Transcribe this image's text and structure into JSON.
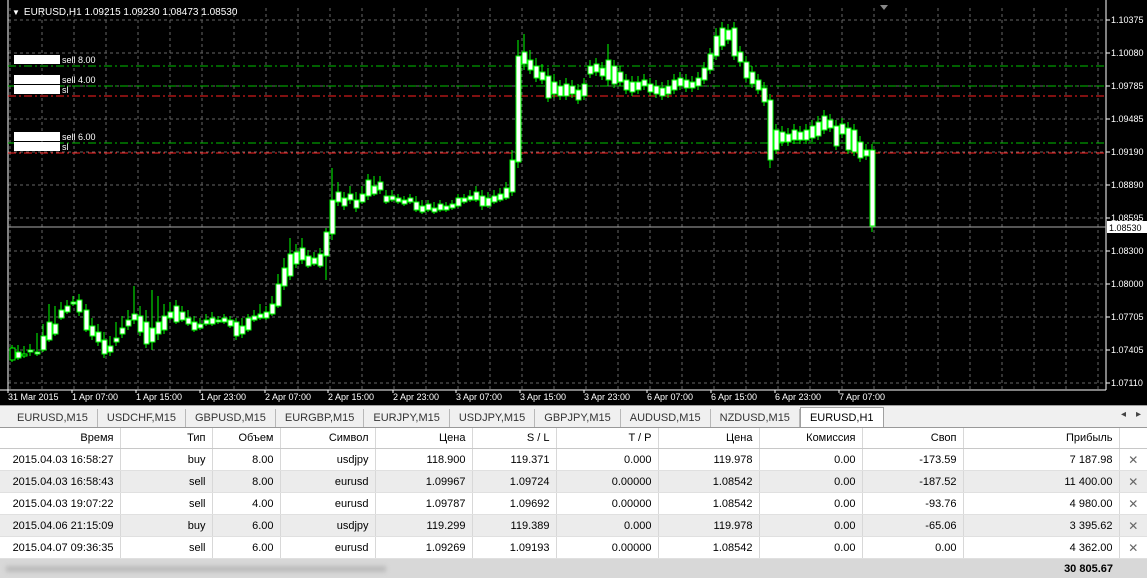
{
  "chart": {
    "title": "EURUSD,H1  1.09215 1.09230 1.08473 1.08530",
    "price_ticks": [
      "1.10375",
      "1.10080",
      "1.09785",
      "1.09485",
      "1.09190",
      "1.08890",
      "1.08595",
      "1.08300",
      "1.08000",
      "1.07705",
      "1.07405",
      "1.07110"
    ],
    "current_price": "1.08530",
    "time_ticks": [
      "31 Mar 2015",
      "1 Apr 07:00",
      "1 Apr 15:00",
      "1 Apr 23:00",
      "2 Apr 07:00",
      "2 Apr 15:00",
      "2 Apr 23:00",
      "3 Apr 07:00",
      "3 Apr 15:00",
      "3 Apr 23:00",
      "6 Apr 07:00",
      "6 Apr 15:00",
      "6 Apr 23:00",
      "7 Apr 07:00"
    ],
    "order_labels": [
      "sell 8.00",
      "sell 4.00",
      "sl",
      "sell 6.00",
      "sl"
    ],
    "colors": {
      "background": "#000000",
      "bull": "#00ff00",
      "grid": "#666666",
      "order_line": "#00c000",
      "sl_line": "#ff2020"
    }
  },
  "tabs": [
    "EURUSD,M15",
    "USDCHF,M15",
    "GBPUSD,M15",
    "EURGBP,M15",
    "EURJPY,M15",
    "USDJPY,M15",
    "GBPJPY,M15",
    "AUDUSD,M15",
    "NZDUSD,M15",
    "EURUSD,H1"
  ],
  "active_tab": "EURUSD,H1",
  "table": {
    "headers": [
      "Время",
      "Тип",
      "Объем",
      "Символ",
      "Цена",
      "S / L",
      "T / P",
      "Цена",
      "Комиссия",
      "Своп",
      "Прибыль"
    ],
    "rows": [
      [
        "2015.04.03 16:58:27",
        "buy",
        "8.00",
        "usdjpy",
        "118.900",
        "119.371",
        "0.000",
        "119.978",
        "0.00",
        "-173.59",
        "7 187.98"
      ],
      [
        "2015.04.03 16:58:43",
        "sell",
        "8.00",
        "eurusd",
        "1.09967",
        "1.09724",
        "0.00000",
        "1.08542",
        "0.00",
        "-187.52",
        "11 400.00"
      ],
      [
        "2015.04.03 19:07:22",
        "sell",
        "4.00",
        "eurusd",
        "1.09787",
        "1.09692",
        "0.00000",
        "1.08542",
        "0.00",
        "-93.76",
        "4 980.00"
      ],
      [
        "2015.04.06 21:15:09",
        "buy",
        "6.00",
        "usdjpy",
        "119.299",
        "119.389",
        "0.000",
        "119.978",
        "0.00",
        "-65.06",
        "3 395.62"
      ],
      [
        "2015.04.07 09:36:35",
        "sell",
        "6.00",
        "eurusd",
        "1.09269",
        "1.09193",
        "0.00000",
        "1.08542",
        "0.00",
        "0.00",
        "4 362.00"
      ]
    ],
    "total_profit": "30 805.67"
  }
}
